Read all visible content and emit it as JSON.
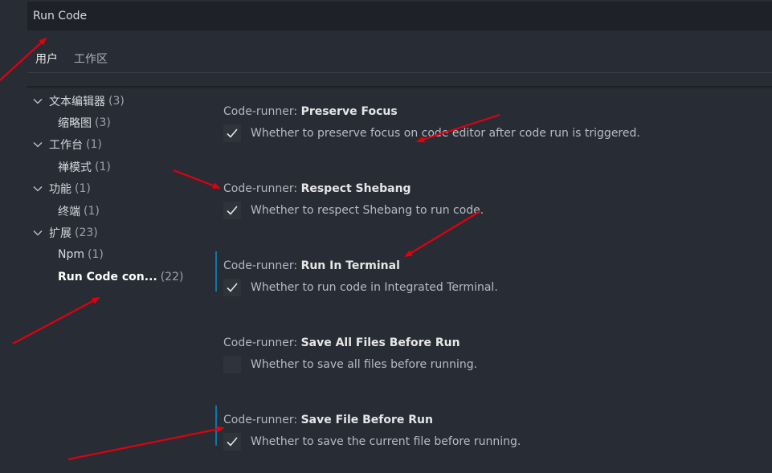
{
  "search": {
    "value": "Run Code"
  },
  "tabs": [
    {
      "label": "用户",
      "active": true
    },
    {
      "label": "工作区",
      "active": false
    }
  ],
  "toc": [
    {
      "name": "文本编辑器",
      "count": "(3)",
      "level": 0,
      "expanded": true
    },
    {
      "name": "缩略图",
      "count": "(3)",
      "level": 1
    },
    {
      "name": "工作台",
      "count": "(1)",
      "level": 0,
      "expanded": true
    },
    {
      "name": "禅模式",
      "count": "(1)",
      "level": 1
    },
    {
      "name": "功能",
      "count": "(1)",
      "level": 0,
      "expanded": true
    },
    {
      "name": "终端",
      "count": "(1)",
      "level": 1
    },
    {
      "name": "扩展",
      "count": "(23)",
      "level": 0,
      "expanded": true
    },
    {
      "name": "Npm",
      "count": "(1)",
      "level": 1
    },
    {
      "name": "Run Code con...",
      "count": "(22)",
      "level": 1,
      "selected": true
    }
  ],
  "settings": [
    {
      "category": "Code-runner: ",
      "key": "Preserve Focus",
      "description": "Whether to preserve focus on code editor after code run is triggered.",
      "checked": true,
      "modified": false
    },
    {
      "category": "Code-runner: ",
      "key": "Respect Shebang",
      "description": "Whether to respect Shebang to run code.",
      "checked": true,
      "modified": false
    },
    {
      "category": "Code-runner: ",
      "key": "Run In Terminal",
      "description": "Whether to run code in Integrated Terminal.",
      "checked": true,
      "modified": true
    },
    {
      "category": "Code-runner: ",
      "key": "Save All Files Before Run",
      "description": "Whether to save all files before running.",
      "checked": false,
      "modified": false
    },
    {
      "category": "Code-runner: ",
      "key": "Save File Before Run",
      "description": "Whether to save the current file before running.",
      "checked": true,
      "modified": true
    }
  ],
  "colors": {
    "background": "#282c34",
    "modified_indicator": "#0f76a8",
    "annotation_arrow": "#e0000f"
  },
  "icons": {
    "expand": "chevron-down-icon",
    "check": "check-icon",
    "annotation": "red-arrow"
  }
}
